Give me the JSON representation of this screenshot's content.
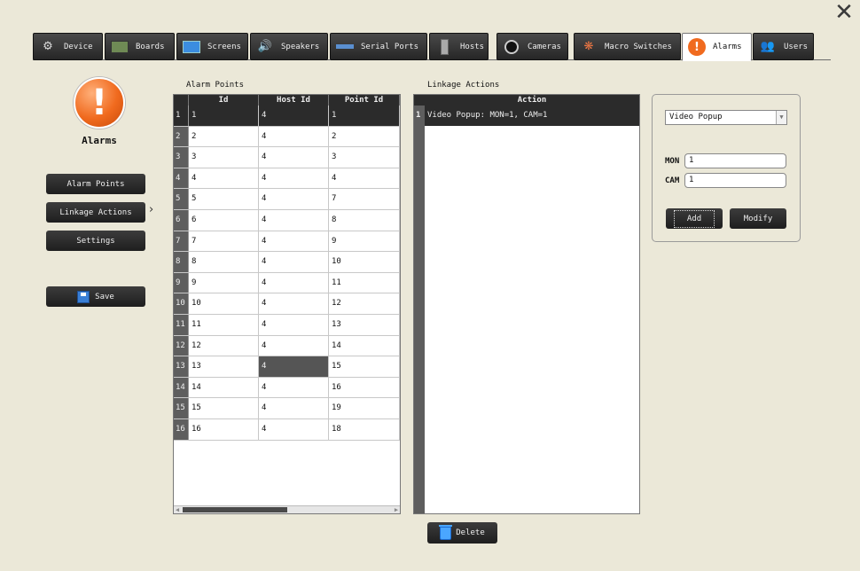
{
  "tabs": [
    {
      "label": "Device",
      "icon": "gear-icon"
    },
    {
      "label": "Boards",
      "icon": "board-icon"
    },
    {
      "label": "Screens",
      "icon": "screen-icon"
    },
    {
      "label": "Speakers",
      "icon": "speaker-icon"
    },
    {
      "label": "Serial Ports",
      "icon": "serial-port-icon"
    },
    {
      "label": "Hosts",
      "icon": "host-icon"
    },
    {
      "label": "Cameras",
      "icon": "camera-icon"
    },
    {
      "label": "Macro Switches",
      "icon": "macro-icon"
    },
    {
      "label": "Alarms",
      "icon": "alarm-icon"
    },
    {
      "label": "Users",
      "icon": "users-icon"
    }
  ],
  "active_tab": "Alarms",
  "sidebar": {
    "title": "Alarms",
    "buttons": [
      "Alarm Points",
      "Linkage Actions",
      "Settings"
    ],
    "selected": "Linkage Actions",
    "save_label": "Save"
  },
  "alarm_points": {
    "label": "Alarm Points",
    "columns": [
      "Id",
      "Host Id",
      "Point Id"
    ],
    "rows": [
      [
        "1",
        "4",
        "1"
      ],
      [
        "2",
        "4",
        "2"
      ],
      [
        "3",
        "4",
        "3"
      ],
      [
        "4",
        "4",
        "4"
      ],
      [
        "5",
        "4",
        "7"
      ],
      [
        "6",
        "4",
        "8"
      ],
      [
        "7",
        "4",
        "9"
      ],
      [
        "8",
        "4",
        "10"
      ],
      [
        "9",
        "4",
        "11"
      ],
      [
        "10",
        "4",
        "12"
      ],
      [
        "11",
        "4",
        "13"
      ],
      [
        "12",
        "4",
        "14"
      ],
      [
        "13",
        "4",
        "15"
      ],
      [
        "14",
        "4",
        "16"
      ],
      [
        "15",
        "4",
        "19"
      ],
      [
        "16",
        "4",
        "18"
      ]
    ]
  },
  "linkage": {
    "label": "Linkage Actions",
    "column": "Action",
    "rows": [
      "Video Popup: MON=1, CAM=1"
    ],
    "delete_label": "Delete"
  },
  "editor": {
    "action_type": "Video Popup",
    "mon_label": "MON",
    "mon_value": "1",
    "cam_label": "CAM",
    "cam_value": "1",
    "add_label": "Add",
    "modify_label": "Modify"
  },
  "colors": {
    "background": "#ebe8d8",
    "dark_button": "#262626",
    "alarm_orange": "#f06a1e",
    "selected_row": "#2b2b2b"
  }
}
